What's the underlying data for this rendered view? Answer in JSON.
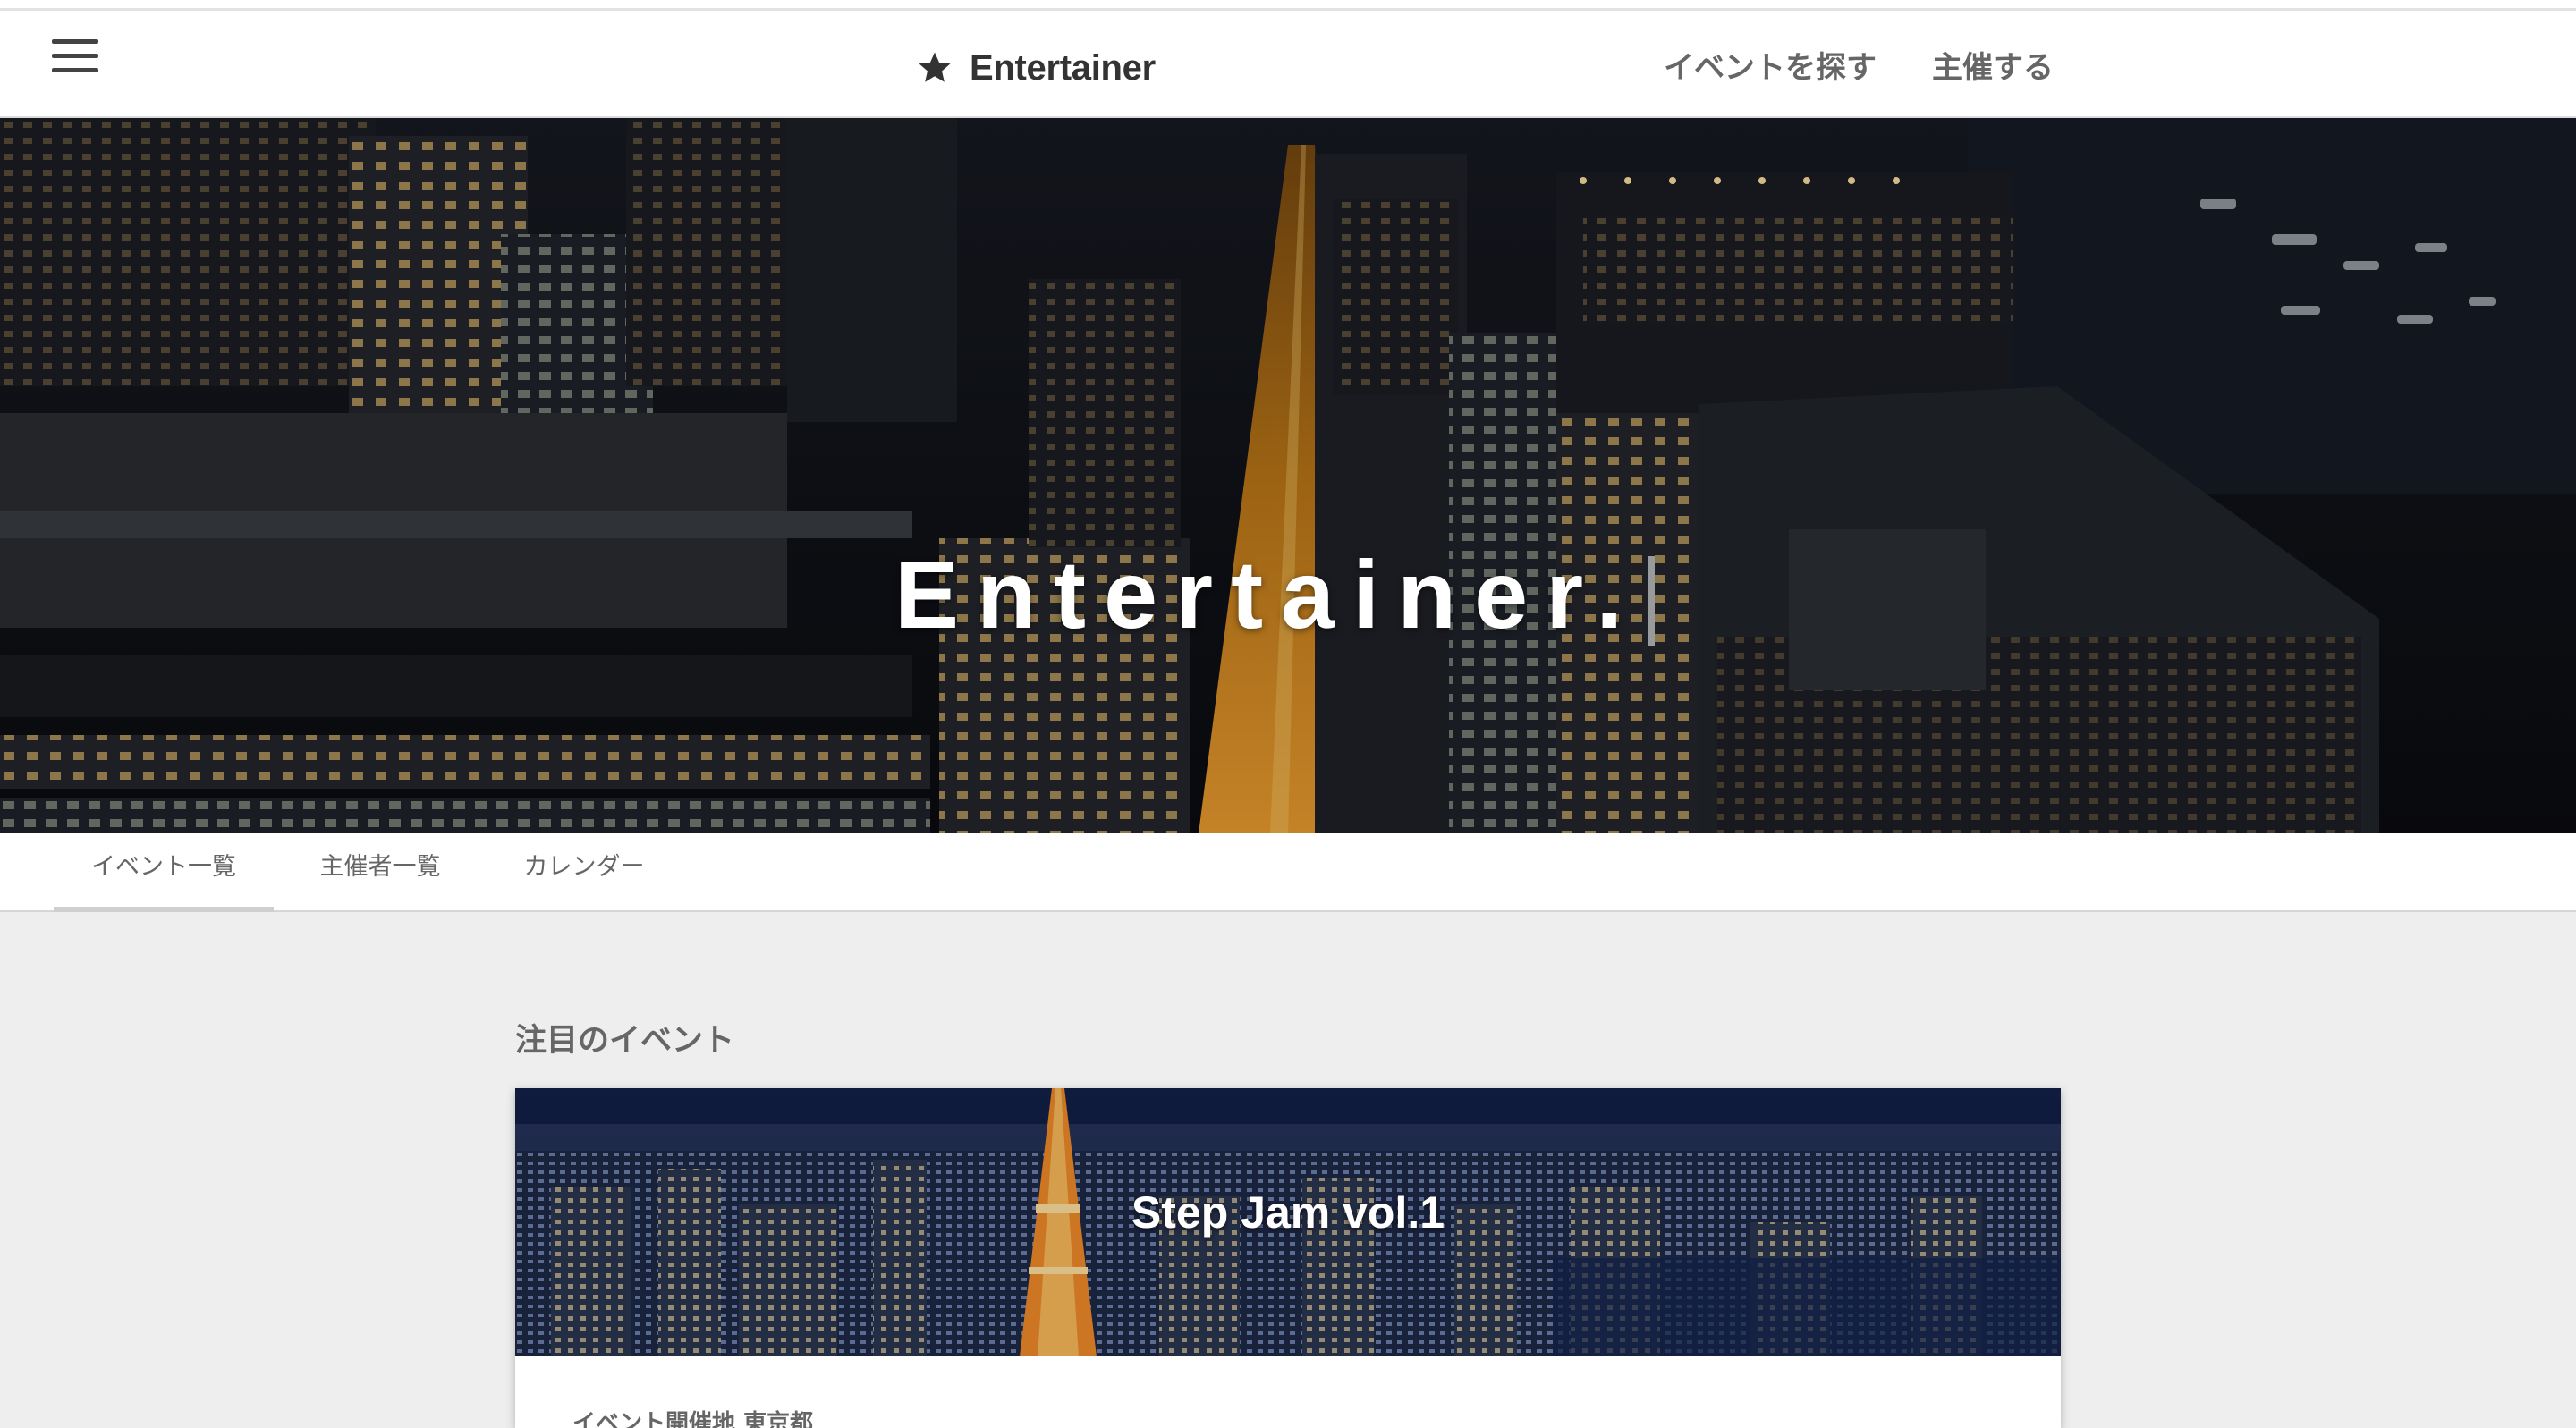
{
  "header": {
    "menu_icon": "hamburger-menu-icon",
    "brand_icon": "star-icon",
    "brand_name": "Entertainer",
    "nav": [
      {
        "label": "イベントを探す"
      },
      {
        "label": "主催する"
      }
    ]
  },
  "hero": {
    "title": "Entertainer."
  },
  "tabs": [
    {
      "label": "イベント一覧",
      "active": true
    },
    {
      "label": "主催者一覧",
      "active": false
    },
    {
      "label": "カレンダー",
      "active": false
    }
  ],
  "featured": {
    "section_title": "注目のイベント",
    "card": {
      "title": "Step Jam vol.1",
      "meta": "イベント開催地 東京都"
    }
  },
  "colors": {
    "header_bg": "#ffffff",
    "page_bg": "#eeeeee",
    "text_dark": "#333333",
    "text_muted": "#666666"
  }
}
